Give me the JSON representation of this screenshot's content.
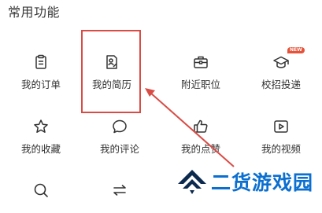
{
  "section": {
    "title": "常用功能"
  },
  "tiles": [
    {
      "label": "我的订单",
      "icon": "clipboard-icon"
    },
    {
      "label": "我的简历",
      "icon": "resume-icon"
    },
    {
      "label": "附近职位",
      "icon": "briefcase-icon"
    },
    {
      "label": "校招投递",
      "icon": "graduation-cap-icon",
      "badge": "NEW"
    },
    {
      "label": "我的收藏",
      "icon": "star-icon"
    },
    {
      "label": "我的评论",
      "icon": "speech-bubble-icon"
    },
    {
      "label": "我的点赞",
      "icon": "thumbs-up-icon"
    },
    {
      "label": "我的视频",
      "icon": "video-play-icon"
    },
    {
      "label": "",
      "icon": "search-icon"
    },
    {
      "label": "",
      "icon": "swap-arrows-icon"
    }
  ],
  "watermark": {
    "text": "二货游戏园"
  },
  "colors": {
    "highlight": "#d94c46",
    "watermark": "#0b6fd0",
    "badge": "#e5533a"
  }
}
